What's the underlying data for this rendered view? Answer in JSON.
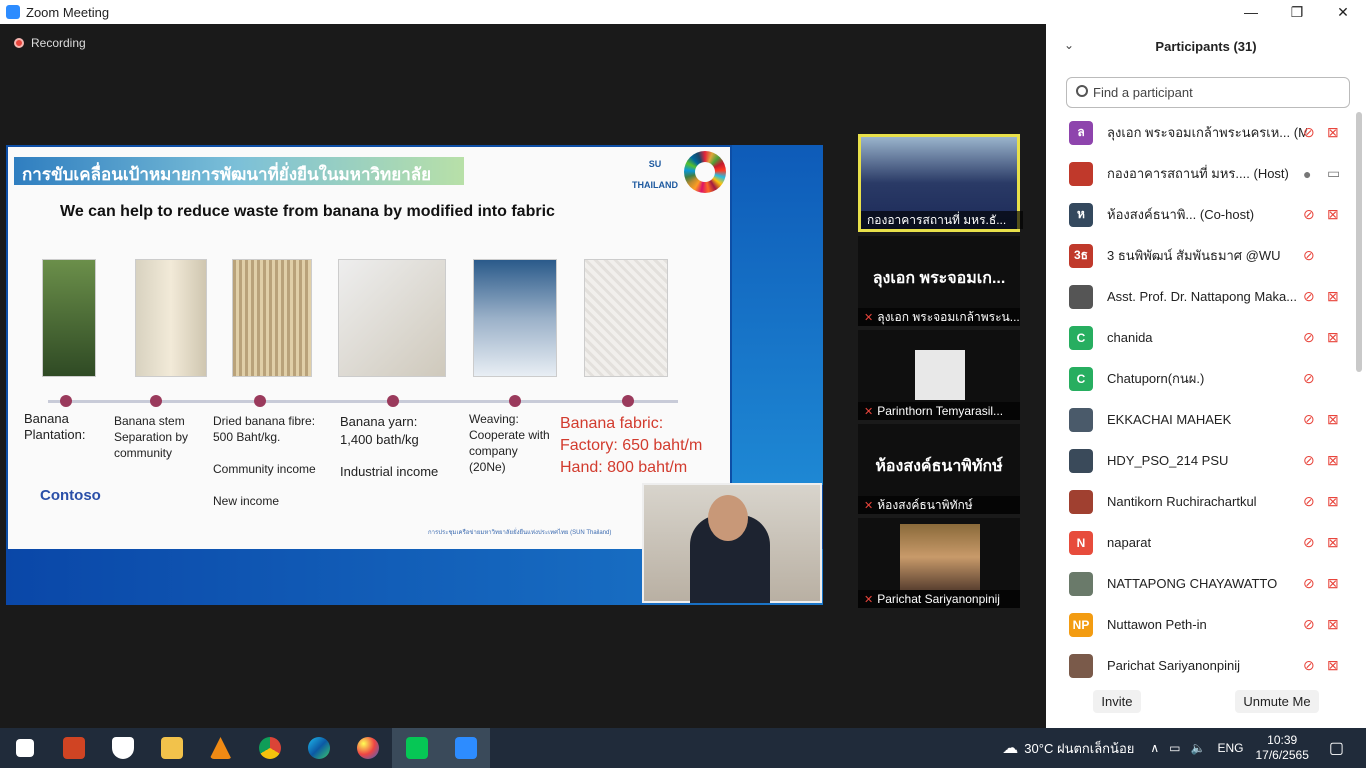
{
  "window": {
    "title": "Zoom Meeting",
    "controls": [
      "—",
      "❐",
      "✕"
    ]
  },
  "recording": {
    "label": "Recording"
  },
  "slide": {
    "thai_title": "การขับเคลื่อนเป้าหมายการพัฒนาที่ยั่งยืนในมหาวิทยาลัย",
    "logo_text": "SU THAILAND",
    "headline": "We can help to reduce waste from banana by modified into fabric",
    "stages": [
      {
        "lines": [
          "Banana",
          "Plantation:"
        ]
      },
      {
        "lines": [
          "Banana stem",
          "Separation by",
          "community"
        ]
      },
      {
        "lines": [
          "Dried banana fibre:",
          "500 Baht/kg.",
          "",
          "Community income",
          "",
          "New income"
        ]
      },
      {
        "lines": [
          "Banana yarn:",
          "1,400 bath/kg",
          "",
          "Industrial income"
        ]
      },
      {
        "lines": [
          "Weaving:",
          "Cooperate with",
          "company",
          "(20Ne)"
        ]
      }
    ],
    "fabric": [
      "Banana fabric:",
      "Factory: 650 baht/m",
      "Hand: 800 baht/m"
    ],
    "contoso": "Contoso",
    "footer_note": "การประชุมเครือข่ายมหาวิทยาลัยยั่งยืนแห่งประเทศไทย (SUN Thailand)"
  },
  "tiles": [
    {
      "name": "กองอาคารสถานที่ มหร.ธั...",
      "big": ""
    },
    {
      "name": "ลุงเอก พระจอมเกล้าพระน...",
      "big": "ลุงเอก พระจอมเก..."
    },
    {
      "name": "Parinthorn Temyarasil...",
      "big": ""
    },
    {
      "name": "ห้องสงค์ธนาพิทักษ์",
      "big": "ห้องสงค์ธนาพิทักษ์"
    },
    {
      "name": "Parichat Sariyanonpinij",
      "big": ""
    }
  ],
  "participants_panel": {
    "title": "Participants (31)",
    "search_placeholder": "Find a participant",
    "invite_label": "Invite",
    "unmute_label": "Unmute Me",
    "items": [
      {
        "avatar": "ล",
        "color": "#8e44ad",
        "name": "ลุงเอก พระจอมเกล้าพระนครเห...",
        "tag": "(Me)",
        "mic": "off",
        "cam": "off"
      },
      {
        "avatar": "",
        "color": "#c0392b",
        "name": "กองอาคารสถานที่ มหร....",
        "tag": "(Host)",
        "mic": "on",
        "cam": "on"
      },
      {
        "avatar": "ห",
        "color": "#34495e",
        "name": "ห้องสงค์ธนาพิ...",
        "tag": "(Co-host)",
        "mic": "off",
        "cam": "off"
      },
      {
        "avatar": "3ธ",
        "color": "#c0392b",
        "name": "3 ธนพิพัฒน์ สัมพันธมาศ @WU",
        "tag": "",
        "mic": "off",
        "cam": ""
      },
      {
        "avatar": "",
        "color": "#555",
        "name": "Asst. Prof. Dr. Nattapong Maka...",
        "tag": "",
        "mic": "off",
        "cam": "off"
      },
      {
        "avatar": "C",
        "color": "#27ae60",
        "name": "chanida",
        "tag": "",
        "mic": "off",
        "cam": "off"
      },
      {
        "avatar": "C",
        "color": "#27ae60",
        "name": "Chatuporn(กนผ.)",
        "tag": "",
        "mic": "off",
        "cam": ""
      },
      {
        "avatar": "",
        "color": "#4a5a6a",
        "name": "EKKACHAI MAHAEK",
        "tag": "",
        "mic": "off",
        "cam": "off"
      },
      {
        "avatar": "",
        "color": "#3a4a5a",
        "name": "HDY_PSO_214 PSU",
        "tag": "",
        "mic": "off",
        "cam": "off"
      },
      {
        "avatar": "",
        "color": "#a04030",
        "name": "Nantikorn Ruchirachartkul",
        "tag": "",
        "mic": "off",
        "cam": "off"
      },
      {
        "avatar": "N",
        "color": "#e74c3c",
        "name": "naparat",
        "tag": "",
        "mic": "off",
        "cam": "off"
      },
      {
        "avatar": "",
        "color": "#6a7a6a",
        "name": "NATTAPONG CHAYAWATTO",
        "tag": "",
        "mic": "off",
        "cam": "off"
      },
      {
        "avatar": "NP",
        "color": "#f39c12",
        "name": "Nuttawon Peth-in",
        "tag": "",
        "mic": "off",
        "cam": "off"
      },
      {
        "avatar": "",
        "color": "#7a5a4a",
        "name": "Parichat Sariyanonpinij",
        "tag": "",
        "mic": "off",
        "cam": "off"
      }
    ]
  },
  "taskbar": {
    "apps": [
      "windows-start",
      "powerpoint",
      "defender",
      "file-explorer",
      "vlc",
      "chrome",
      "edge",
      "paint",
      "line",
      "zoom"
    ],
    "weather": "30°C  ฝนตกเล็กน้อย",
    "lang": "ENG",
    "time": "10:39",
    "date": "17/6/2565"
  }
}
